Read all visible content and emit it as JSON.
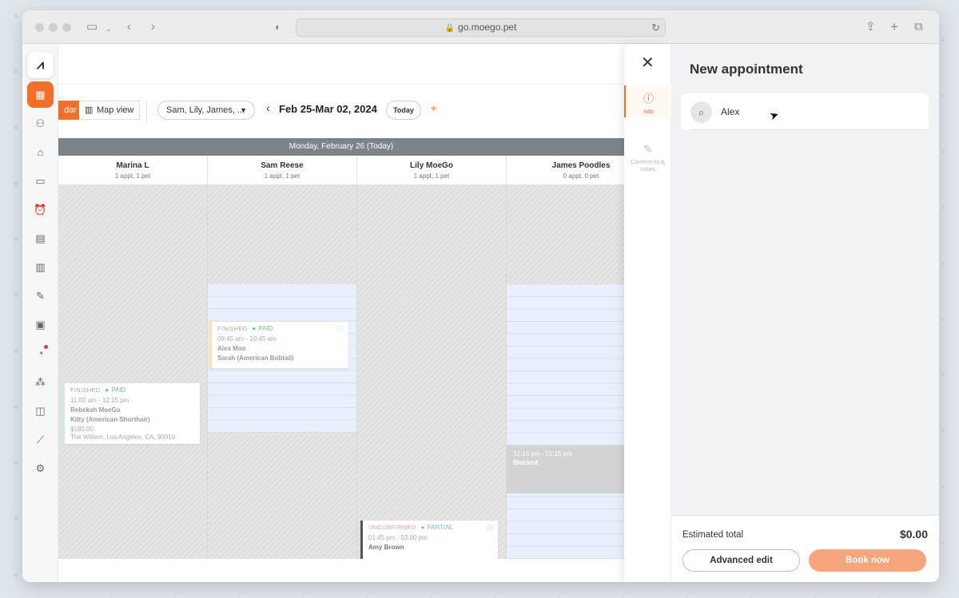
{
  "browser": {
    "url": "go.moego.pet"
  },
  "calendar": {
    "view_calendar": "dar",
    "view_map": "Map view",
    "staff_filter": "Sam, Lily, James, ...",
    "date_range": "Feb 25-Mar 02, 2024",
    "today_label": "Today",
    "day_header": "Monday, February 26 (Today)",
    "columns": [
      {
        "name": "Marina L",
        "count": "1 appt, 1 pet"
      },
      {
        "name": "Sam Reese",
        "count": "1 appt, 1 pet"
      },
      {
        "name": "Lily MoeGo",
        "count": "1 appt, 1 pet"
      },
      {
        "name": "James Poodles",
        "count": "0 appt, 0 pet"
      }
    ],
    "appointments": [
      {
        "status": "FINISHED",
        "pay": "PAID",
        "time": "09:45 am - 10:45 am",
        "client": "Alex Moo",
        "pet": "Sarah (American Bobtail)"
      },
      {
        "status": "FINISHED",
        "pay": "PAID",
        "time": "11:00 am - 12:15 pm",
        "client": "Rebekah MoeGo",
        "pet": "Kitty (American Shorthair)",
        "price": "$180.00",
        "address": "The Wiltern, Los Angeles, CA, 90010"
      },
      {
        "status": "UNCONFIRMED",
        "pay": "PARTIAL",
        "time": "01:45 pm - 03:00 pm",
        "client": "Amy Brown"
      }
    ],
    "blocked": {
      "time": "12:15 pm - 01:15 pm",
      "label": "Blocked"
    }
  },
  "drawer": {
    "title": "New appointment",
    "tabs": [
      {
        "label": "Info"
      },
      {
        "label": "Comments & notes"
      }
    ],
    "search_value": "Alex",
    "estimated_total_label": "Estimated total",
    "estimated_total_value": "$0.00",
    "advanced_edit_label": "Advanced edit",
    "book_now_label": "Book now"
  },
  "colors": {
    "accent": "#f26f2a",
    "book_button": "#f7a57c",
    "day_header": "#7d8489",
    "paid": "#6cc690"
  }
}
